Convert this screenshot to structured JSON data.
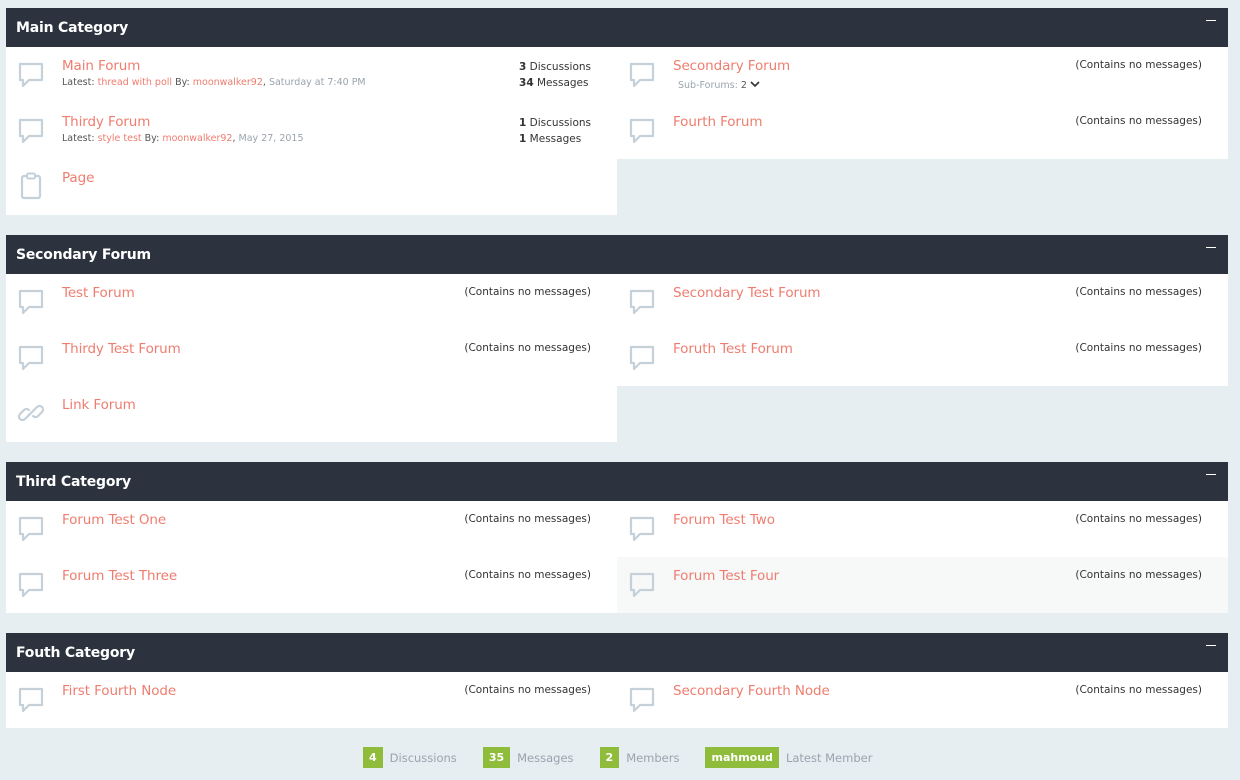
{
  "categories": [
    {
      "title": "Main Category",
      "nodes": [
        {
          "title": "Main Forum",
          "latest_prefix": "Latest: ",
          "latest_thread": "thread with poll",
          "by": " By: ",
          "user": "moonwalker92",
          "sep": ", ",
          "date": "Saturday at 7:40 PM",
          "discussions": "3",
          "discussions_label": " Discussions",
          "messages": "34",
          "messages_label": " Messages"
        },
        {
          "title": "Secondary Forum",
          "sub_label": "Sub-Forums: ",
          "sub_count": "2",
          "no_msg": "(Contains no messages)"
        },
        {
          "title": "Thirdy Forum",
          "latest_prefix": "Latest: ",
          "latest_thread": "style test",
          "by": " By: ",
          "user": "moonwalker92",
          "sep": ", ",
          "date": "May 27, 2015",
          "discussions": "1",
          "discussions_label": " Discussions",
          "messages": "1",
          "messages_label": " Messages"
        },
        {
          "title": "Fourth Forum",
          "no_msg": "(Contains no messages)"
        },
        {
          "title": "Page"
        }
      ]
    },
    {
      "title": "Secondary Forum",
      "nodes": [
        {
          "title": "Test Forum",
          "no_msg": "(Contains no messages)"
        },
        {
          "title": "Secondary Test Forum",
          "no_msg": "(Contains no messages)"
        },
        {
          "title": "Thirdy Test Forum",
          "no_msg": "(Contains no messages)"
        },
        {
          "title": "Foruth Test Forum",
          "no_msg": "(Contains no messages)"
        },
        {
          "title": "Link Forum"
        }
      ]
    },
    {
      "title": "Third Category",
      "nodes": [
        {
          "title": "Forum Test One",
          "no_msg": "(Contains no messages)"
        },
        {
          "title": "Forum Test Two",
          "no_msg": "(Contains no messages)"
        },
        {
          "title": "Forum Test Three",
          "no_msg": "(Contains no messages)"
        },
        {
          "title": "Forum Test Four",
          "no_msg": "(Contains no messages)"
        }
      ]
    },
    {
      "title": "Fouth Category",
      "nodes": [
        {
          "title": "First Fourth Node",
          "no_msg": "(Contains no messages)"
        },
        {
          "title": "Secondary Fourth Node",
          "no_msg": "(Contains no messages)"
        }
      ]
    }
  ],
  "footer": {
    "discussions": {
      "value": "4",
      "label": "Discussions"
    },
    "messages": {
      "value": "35",
      "label": "Messages"
    },
    "members": {
      "value": "2",
      "label": "Members"
    },
    "latest_member": {
      "value": "mahmoud",
      "label": "Latest Member"
    }
  },
  "colors": {
    "header_bg": "#2c333f",
    "link": "#ef7d6f",
    "badge": "#8fbc3a",
    "page_bg": "#e6eef2"
  },
  "icons": {
    "forum": "speech-bubble-icon",
    "page": "clipboard-icon",
    "link": "chain-link-icon",
    "collapse": "minus-icon"
  }
}
